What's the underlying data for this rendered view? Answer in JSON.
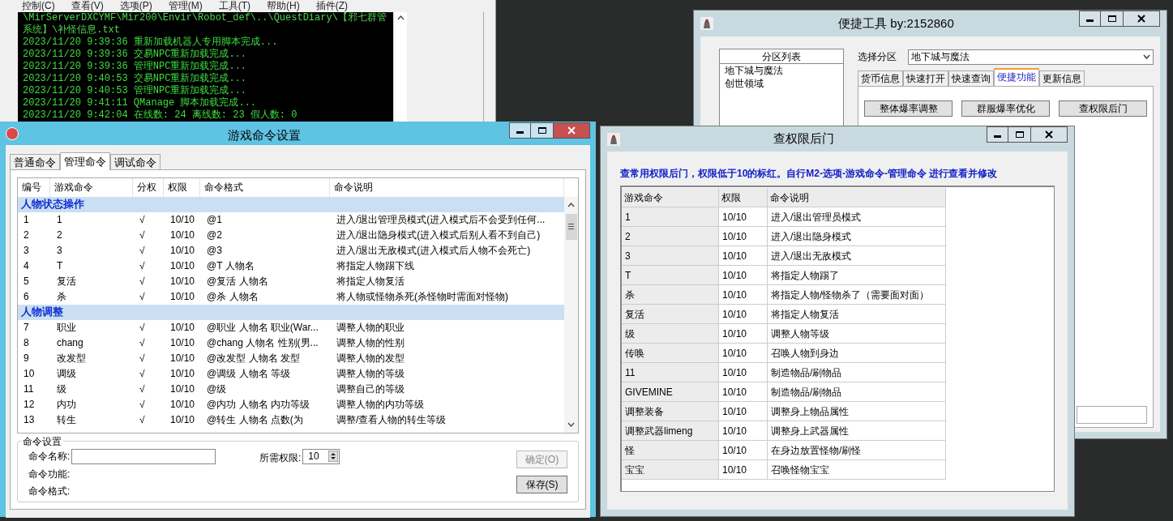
{
  "console_window": {
    "menu": [
      "控制(C)",
      "查看(V)",
      "选项(P)",
      "管理(M)",
      "工具(T)",
      "帮助(H)",
      "插件(Z)"
    ],
    "log_lines": [
      "\\MirServerDXCYMF\\Mir200\\Envir\\Robot_def\\..\\QuestDiary\\【邪七群管",
      "系统】\\补怪信息.txt",
      "2023/11/20 9:39:36 重新加载机器人专用脚本完成...",
      "2023/11/20 9:39:36 交易NPC重新加载完成...",
      "2023/11/20 9:39:36 管理NPC重新加载完成...",
      "2023/11/20 9:40:53 交易NPC重新加载完成...",
      "2023/11/20 9:40:53 管理NPC重新加载完成...",
      "2023/11/20 9:41:11 QManage 脚本加载完成...",
      "2023/11/20 9:42:04 在线数: 24 离线数: 23 假人数: 0"
    ]
  },
  "command_window": {
    "title": "游戏命令设置",
    "tabs": [
      {
        "label": "普通命令",
        "selected": false
      },
      {
        "label": "管理命令",
        "selected": true
      },
      {
        "label": "调试命令",
        "selected": false
      }
    ],
    "table": {
      "columns": [
        "编号",
        "游戏命令",
        "分权",
        "权限",
        "命令格式",
        "命令说明"
      ],
      "groups": [
        {
          "title": "人物状态操作",
          "rows": [
            [
              "1",
              "1",
              "√",
              "10/10",
              "@1",
              "进入/退出管理员模式(进入模式后不会受到任何..."
            ],
            [
              "2",
              "2",
              "√",
              "10/10",
              "@2",
              "进入/退出隐身模式(进入模式后别人看不到自己)"
            ],
            [
              "3",
              "3",
              "√",
              "10/10",
              "@3",
              "进入/退出无敌模式(进入模式后人物不会死亡)"
            ],
            [
              "4",
              "T",
              "√",
              "10/10",
              "@T 人物名",
              "将指定人物踢下线"
            ],
            [
              "5",
              "复活",
              "√",
              "10/10",
              "@复活 人物名",
              "将指定人物复活"
            ],
            [
              "6",
              "杀",
              "√",
              "10/10",
              "@杀 人物名",
              "将人物或怪物杀死(杀怪物时需面对怪物)"
            ]
          ]
        },
        {
          "title": "人物调整",
          "rows": [
            [
              "7",
              "职业",
              "√",
              "10/10",
              "@职业 人物名 职业(War...",
              "调整人物的职业"
            ],
            [
              "8",
              "chang",
              "√",
              "10/10",
              "@chang 人物名 性别(男...",
              "调整人物的性别"
            ],
            [
              "9",
              "改发型",
              "√",
              "10/10",
              "@改发型 人物名 发型",
              "调整人物的发型"
            ],
            [
              "10",
              "调级",
              "√",
              "10/10",
              "@调级 人物名 等级",
              "调整人物的等级"
            ],
            [
              "11",
              "级",
              "√",
              "10/10",
              "@级",
              "调整自己的等级"
            ],
            [
              "12",
              "内功",
              "√",
              "10/10",
              "@内功 人物名 内功等级",
              "调整人物的内功等级"
            ],
            [
              "13",
              "转生",
              "√",
              "10/10",
              "@转生 人物名 点数(为",
              "调整/查看人物的转生等级"
            ]
          ]
        }
      ]
    },
    "settings": {
      "title": "命令设置",
      "name_label": "命令名称:",
      "permission_label": "所需权限:",
      "permission_value": "10",
      "function_label": "命令功能:",
      "format_label": "命令格式:",
      "buttons": [
        {
          "label": "确定(O)",
          "disabled": true
        },
        {
          "label": "保存(S)",
          "disabled": false
        }
      ]
    }
  },
  "tool_window": {
    "title": "便捷工具 by:2152860",
    "partition_list": {
      "header": "分区列表",
      "items": [
        "地下城与魔法",
        "创世领域"
      ]
    },
    "select_label": "选择分区",
    "select_value": "地下城与魔法",
    "tabs": [
      {
        "label": "货币信息",
        "selected": false
      },
      {
        "label": "快速打开",
        "selected": false
      },
      {
        "label": "快速查询",
        "selected": false
      },
      {
        "label": "便捷功能",
        "selected": true
      },
      {
        "label": "更新信息",
        "selected": false
      }
    ],
    "buttons": [
      "整体爆率调整",
      "群服爆率优化",
      "查权限后门"
    ]
  },
  "backdoor_window": {
    "title": "查权限后门",
    "notice": "查常用权限后门，权限低于10的标红。自行M2-选项-游戏命令-管理命令  进行查看并修改",
    "table": {
      "columns": [
        "游戏命令",
        "权限",
        "命令说明"
      ],
      "rows": [
        [
          "1",
          "10/10",
          "进入/退出管理员模式"
        ],
        [
          "2",
          "10/10",
          "进入/退出隐身模式"
        ],
        [
          "3",
          "10/10",
          "进入/退出无敌模式"
        ],
        [
          "T",
          "10/10",
          "将指定人物踢了"
        ],
        [
          "杀",
          "10/10",
          "将指定人物/怪物杀了（需要面对面）"
        ],
        [
          "复活",
          "10/10",
          "将指定人物复活"
        ],
        [
          "级",
          "10/10",
          "调整人物等级"
        ],
        [
          "传唤",
          "10/10",
          "召唤人物到身边"
        ],
        [
          "11",
          "10/10",
          "制造物品/刷物品"
        ],
        [
          "GIVEMINE",
          "10/10",
          "制造物品/刷物品"
        ],
        [
          "调整装备",
          "10/10",
          "调整身上物品属性"
        ],
        [
          "调整武器limeng",
          "10/10",
          "调整身上武器属性"
        ],
        [
          "怪",
          "10/10",
          "在身边放置怪物/刷怪"
        ],
        [
          "宝宝",
          "10/10",
          "召唤怪物宝宝"
        ]
      ]
    }
  }
}
